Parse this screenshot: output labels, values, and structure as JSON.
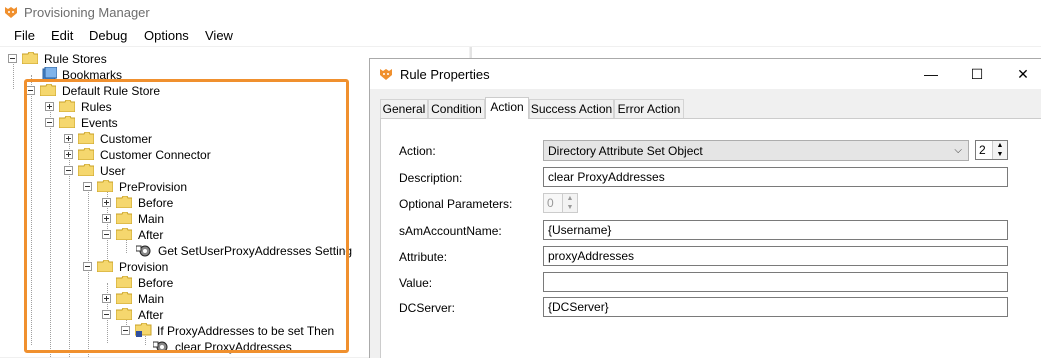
{
  "app": {
    "title": "Provisioning Manager",
    "icon": "app-logo-icon",
    "accent": "#f0902e"
  },
  "menu": {
    "items": [
      "File",
      "Edit",
      "Debug",
      "Options",
      "View"
    ]
  },
  "tree": {
    "nodes": [
      "Rule Stores",
      "Bookmarks",
      "Default Rule Store",
      "Rules",
      "Events",
      "Customer",
      "Customer Connector",
      "User",
      "PreProvision",
      "Before",
      "Main",
      "After",
      "Get SetUserProxyAddresses Setting",
      "Provision",
      "Before",
      "Main",
      "After",
      "If ProxyAddresses to be set Then",
      "clear ProxyAddresses"
    ]
  },
  "dialog": {
    "title": "Rule Properties",
    "controls": {
      "minimize": "—",
      "maximize": "☐",
      "close": "✕"
    },
    "tabs": [
      "General",
      "Condition",
      "Action",
      "Success Action",
      "Error Action"
    ],
    "active_tab": "Action",
    "form": {
      "action_label": "Action:",
      "action_value": "Directory Attribute Set Object",
      "action_count": "2",
      "description_label": "Description:",
      "description_value": "clear ProxyAddresses",
      "optional_label": "Optional Parameters:",
      "optional_value": "0",
      "samaccount_label": "sAmAccountName:",
      "samaccount_value": "{Username}",
      "attribute_label": "Attribute:",
      "attribute_value": "proxyAddresses",
      "value_label": "Value:",
      "value_value": "",
      "dcserver_label": "DCServer:",
      "dcserver_value": "{DCServer}"
    }
  }
}
